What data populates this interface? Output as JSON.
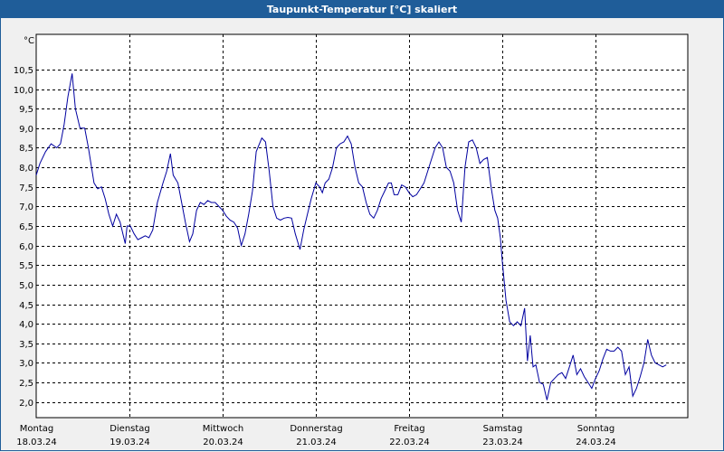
{
  "window": {
    "title": "Taupunkt-Temperatur [°C] skaliert"
  },
  "colors": {
    "line": "#0000a0",
    "grid": "#000000",
    "plot_bg": "#ffffff",
    "titlebar": "#1f5d99"
  },
  "chart_data": {
    "type": "line",
    "title": "Taupunkt-Temperatur [°C] skaliert",
    "unit": "°C",
    "xlabel": "",
    "ylabel": "",
    "ylim": [
      1.6,
      11.4
    ],
    "xlim": [
      0,
      7
    ],
    "grid": true,
    "y_ticks": [
      2.0,
      2.5,
      3.0,
      3.5,
      4.0,
      4.5,
      5.0,
      5.5,
      6.0,
      6.5,
      7.0,
      7.5,
      8.0,
      8.5,
      9.0,
      9.5,
      10.0,
      10.5
    ],
    "y_tick_labels": [
      "2,0",
      "2,5",
      "3,0",
      "3,5",
      "4,0",
      "4,5",
      "5,0",
      "5,5",
      "6,0",
      "6,5",
      "7,0",
      "7,5",
      "8,0",
      "8,5",
      "9,0",
      "9,5",
      "10,0",
      "10,5"
    ],
    "x_ticks": [
      {
        "day": "Montag",
        "date": "18.03.24",
        "x": 0
      },
      {
        "day": "Dienstag",
        "date": "19.03.24",
        "x": 1
      },
      {
        "day": "Mittwoch",
        "date": "20.03.24",
        "x": 2
      },
      {
        "day": "Donnerstag",
        "date": "21.03.24",
        "x": 3
      },
      {
        "day": "Freitag",
        "date": "22.03.24",
        "x": 4
      },
      {
        "day": "Samstag",
        "date": "23.03.24",
        "x": 5
      },
      {
        "day": "Sonntag",
        "date": "24.03.24",
        "x": 6
      }
    ],
    "series": [
      {
        "points": [
          [
            0.0,
            7.8
          ],
          [
            0.04,
            8.1
          ],
          [
            0.1,
            8.4
          ],
          [
            0.16,
            8.6
          ],
          [
            0.22,
            8.5
          ],
          [
            0.26,
            8.6
          ],
          [
            0.3,
            9.1
          ],
          [
            0.34,
            9.8
          ],
          [
            0.385,
            10.4
          ],
          [
            0.42,
            9.5
          ],
          [
            0.47,
            9.0
          ],
          [
            0.52,
            9.0
          ],
          [
            0.56,
            8.5
          ],
          [
            0.62,
            7.6
          ],
          [
            0.66,
            7.45
          ],
          [
            0.7,
            7.5
          ],
          [
            0.74,
            7.2
          ],
          [
            0.78,
            6.8
          ],
          [
            0.82,
            6.5
          ],
          [
            0.86,
            6.8
          ],
          [
            0.9,
            6.6
          ],
          [
            0.93,
            6.3
          ],
          [
            0.955,
            6.05
          ],
          [
            0.975,
            6.5
          ],
          [
            1.01,
            6.5
          ],
          [
            1.05,
            6.3
          ],
          [
            1.09,
            6.15
          ],
          [
            1.13,
            6.2
          ],
          [
            1.17,
            6.25
          ],
          [
            1.21,
            6.2
          ],
          [
            1.25,
            6.4
          ],
          [
            1.3,
            7.1
          ],
          [
            1.36,
            7.6
          ],
          [
            1.4,
            7.9
          ],
          [
            1.44,
            8.35
          ],
          [
            1.47,
            7.8
          ],
          [
            1.52,
            7.6
          ],
          [
            1.56,
            7.1
          ],
          [
            1.6,
            6.6
          ],
          [
            1.645,
            6.1
          ],
          [
            1.68,
            6.3
          ],
          [
            1.72,
            6.9
          ],
          [
            1.76,
            7.1
          ],
          [
            1.8,
            7.05
          ],
          [
            1.84,
            7.15
          ],
          [
            1.88,
            7.1
          ],
          [
            1.92,
            7.1
          ],
          [
            1.96,
            7.0
          ],
          [
            2.0,
            6.9
          ],
          [
            2.04,
            6.75
          ],
          [
            2.08,
            6.65
          ],
          [
            2.12,
            6.6
          ],
          [
            2.16,
            6.45
          ],
          [
            2.2,
            6.0
          ],
          [
            2.24,
            6.3
          ],
          [
            2.28,
            6.8
          ],
          [
            2.32,
            7.4
          ],
          [
            2.36,
            8.4
          ],
          [
            2.42,
            8.75
          ],
          [
            2.46,
            8.65
          ],
          [
            2.5,
            7.9
          ],
          [
            2.54,
            7.0
          ],
          [
            2.58,
            6.7
          ],
          [
            2.62,
            6.65
          ],
          [
            2.66,
            6.7
          ],
          [
            2.7,
            6.72
          ],
          [
            2.74,
            6.7
          ],
          [
            2.78,
            6.3
          ],
          [
            2.83,
            5.9
          ],
          [
            2.87,
            6.4
          ],
          [
            2.91,
            6.8
          ],
          [
            2.95,
            7.2
          ],
          [
            3.0,
            7.6
          ],
          [
            3.04,
            7.5
          ],
          [
            3.07,
            7.35
          ],
          [
            3.1,
            7.6
          ],
          [
            3.14,
            7.7
          ],
          [
            3.18,
            8.0
          ],
          [
            3.22,
            8.5
          ],
          [
            3.26,
            8.6
          ],
          [
            3.3,
            8.65
          ],
          [
            3.34,
            8.8
          ],
          [
            3.38,
            8.6
          ],
          [
            3.42,
            8.0
          ],
          [
            3.46,
            7.6
          ],
          [
            3.5,
            7.5
          ],
          [
            3.54,
            7.1
          ],
          [
            3.58,
            6.8
          ],
          [
            3.62,
            6.7
          ],
          [
            3.66,
            6.9
          ],
          [
            3.7,
            7.2
          ],
          [
            3.74,
            7.4
          ],
          [
            3.78,
            7.6
          ],
          [
            3.81,
            7.6
          ],
          [
            3.84,
            7.3
          ],
          [
            3.88,
            7.3
          ],
          [
            3.92,
            7.55
          ],
          [
            3.96,
            7.5
          ],
          [
            4.0,
            7.35
          ],
          [
            4.04,
            7.25
          ],
          [
            4.08,
            7.3
          ],
          [
            4.12,
            7.45
          ],
          [
            4.16,
            7.6
          ],
          [
            4.2,
            7.9
          ],
          [
            4.24,
            8.2
          ],
          [
            4.28,
            8.5
          ],
          [
            4.32,
            8.65
          ],
          [
            4.36,
            8.5
          ],
          [
            4.4,
            8.0
          ],
          [
            4.44,
            7.9
          ],
          [
            4.48,
            7.6
          ],
          [
            4.52,
            6.9
          ],
          [
            4.56,
            6.6
          ],
          [
            4.6,
            8.0
          ],
          [
            4.64,
            8.65
          ],
          [
            4.68,
            8.7
          ],
          [
            4.72,
            8.5
          ],
          [
            4.76,
            8.1
          ],
          [
            4.8,
            8.2
          ],
          [
            4.84,
            8.25
          ],
          [
            4.88,
            7.5
          ],
          [
            4.92,
            6.9
          ],
          [
            4.95,
            6.7
          ],
          [
            4.98,
            6.2
          ],
          [
            5.0,
            5.6
          ],
          [
            5.04,
            4.6
          ],
          [
            5.08,
            4.05
          ],
          [
            5.12,
            3.95
          ],
          [
            5.16,
            4.05
          ],
          [
            5.2,
            3.95
          ],
          [
            5.24,
            4.4
          ],
          [
            5.27,
            3.05
          ],
          [
            5.3,
            3.7
          ],
          [
            5.33,
            2.9
          ],
          [
            5.36,
            2.95
          ],
          [
            5.4,
            2.5
          ],
          [
            5.44,
            2.45
          ],
          [
            5.48,
            2.05
          ],
          [
            5.52,
            2.5
          ],
          [
            5.56,
            2.6
          ],
          [
            5.6,
            2.7
          ],
          [
            5.64,
            2.75
          ],
          [
            5.68,
            2.6
          ],
          [
            5.72,
            2.9
          ],
          [
            5.76,
            3.2
          ],
          [
            5.8,
            2.7
          ],
          [
            5.84,
            2.85
          ],
          [
            5.88,
            2.65
          ],
          [
            5.92,
            2.5
          ],
          [
            5.96,
            2.35
          ],
          [
            6.0,
            2.6
          ],
          [
            6.04,
            2.8
          ],
          [
            6.08,
            3.1
          ],
          [
            6.12,
            3.35
          ],
          [
            6.16,
            3.3
          ],
          [
            6.2,
            3.3
          ],
          [
            6.24,
            3.4
          ],
          [
            6.28,
            3.3
          ],
          [
            6.32,
            2.7
          ],
          [
            6.36,
            2.9
          ],
          [
            6.4,
            2.15
          ],
          [
            6.44,
            2.35
          ],
          [
            6.48,
            2.65
          ],
          [
            6.52,
            3.0
          ],
          [
            6.56,
            3.6
          ],
          [
            6.6,
            3.2
          ],
          [
            6.64,
            3.0
          ],
          [
            6.68,
            2.95
          ],
          [
            6.72,
            2.9
          ],
          [
            6.76,
            2.95
          ]
        ]
      }
    ]
  }
}
